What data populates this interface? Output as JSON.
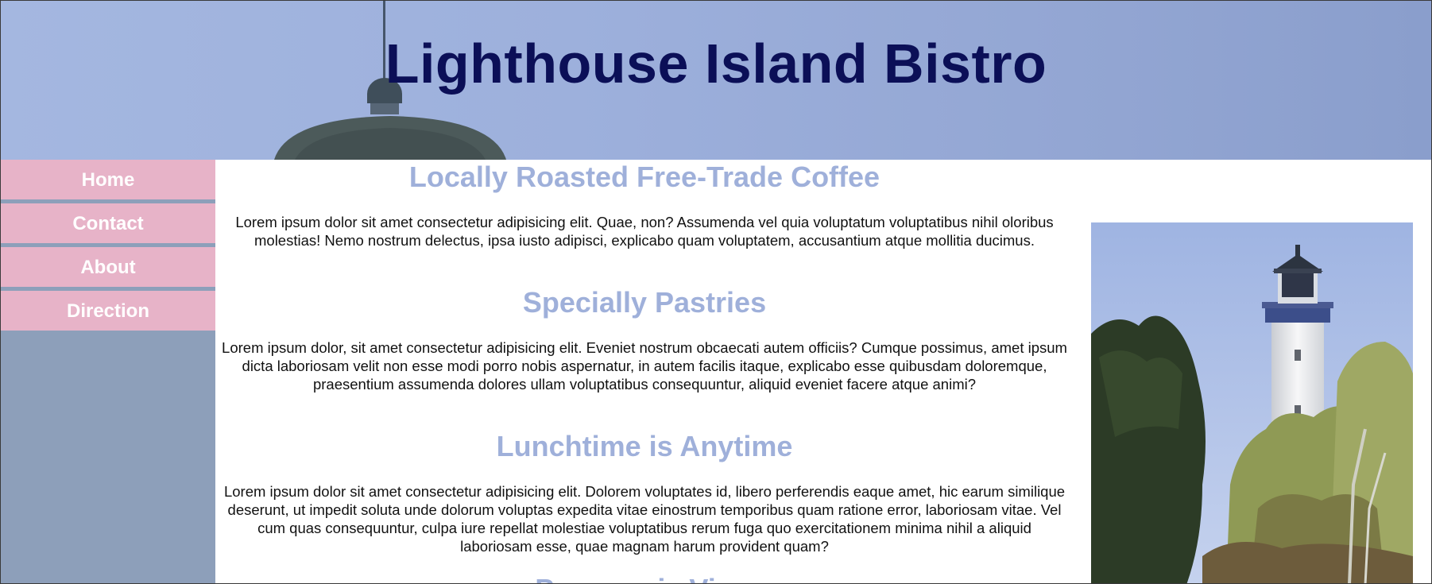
{
  "header": {
    "title": "Lighthouse Island Bistro"
  },
  "nav": {
    "items": [
      {
        "label": "Home"
      },
      {
        "label": "Contact"
      },
      {
        "label": "About"
      },
      {
        "label": "Direction"
      }
    ]
  },
  "sections": [
    {
      "heading": "Locally Roasted Free-Trade Coffee",
      "text": "Lorem ipsum dolor sit amet consectetur adipisicing elit. Quae, non? Assumenda vel quia voluptatum voluptatibus nihil oloribus molestias! Nemo nostrum delectus, ipsa iusto adipisci, explicabo quam voluptatem, accusantium atque mollitia ducimus."
    },
    {
      "heading": "Specially Pastries",
      "text": "Lorem ipsum dolor, sit amet consectetur adipisicing elit. Eveniet nostrum obcaecati autem officiis? Cumque possimus, amet ipsum dicta laboriosam velit non esse modi porro nobis aspernatur, in autem facilis itaque, explicabo esse quibusdam doloremque, praesentium assumenda dolores ullam voluptatibus consequuntur, aliquid eveniet facere atque animi?"
    },
    {
      "heading": "Lunchtime is Anytime",
      "text": "Lorem ipsum dolor sit amet consectetur adipisicing elit. Dolorem voluptates id, libero perferendis eaque amet, hic earum similique deserunt, ut impedit soluta unde dolorum voluptas expedita vitae einostrum temporibus quam ratione error, laboriosam vitae. Vel cum quas consequuntur, culpa iure repellat molestiae voluptatibus rerum fuga quo exercitationem minima nihil a aliquid laboriosam esse, quae magnam harum provident quam?"
    },
    {
      "heading": "Panoramic View"
    }
  ],
  "colors": {
    "header_bg": "#9db0dc",
    "title": "#0b0f57",
    "nav_item_bg": "#e7b3c8",
    "sidebar_bg": "#8d9fba",
    "heading": "#9fb0da"
  }
}
